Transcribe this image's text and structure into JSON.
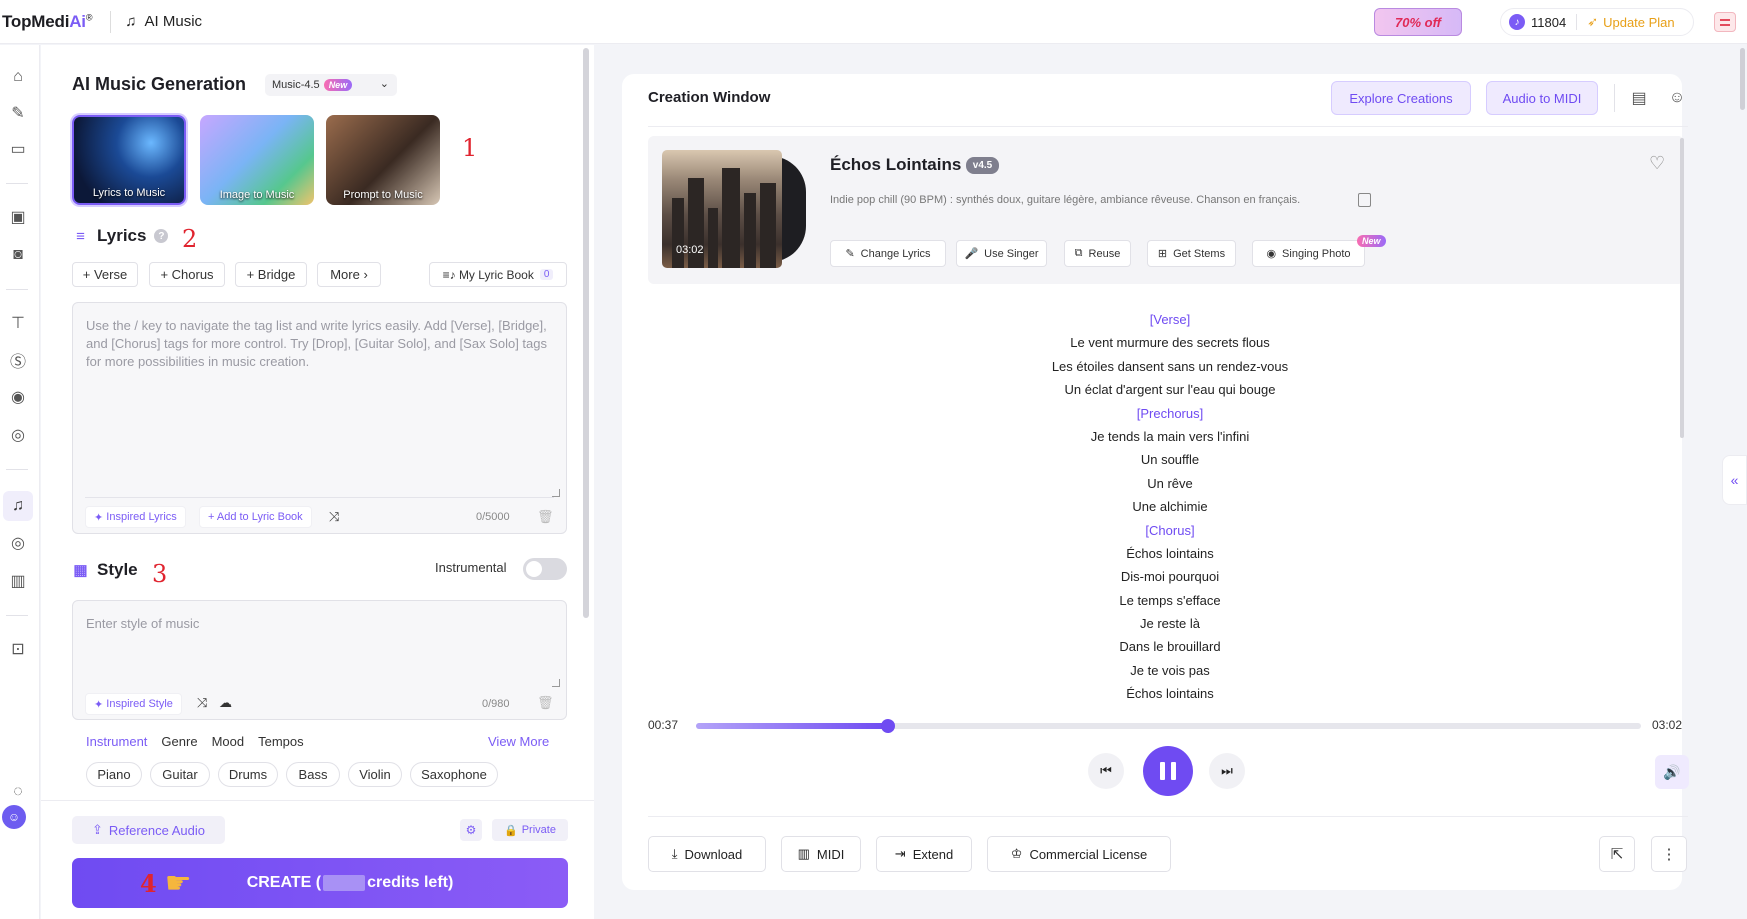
{
  "topbar": {
    "logo_text": "TopMedi",
    "logo_ai": "Ai",
    "logo_reg": "®",
    "app_icon": "music-note-icon",
    "app_title": "AI Music",
    "promo": "70% off",
    "credits": "11804",
    "update_plan": "Update Plan"
  },
  "sidebar": {
    "icons": [
      "home-icon",
      "brush-icon",
      "folder-icon",
      "video-ai-icon",
      "camera-icon",
      "translate-icon",
      "subtitle-icon",
      "voice-icon",
      "image-ai-icon",
      "music-note-icon",
      "vinyl-icon",
      "piano-icon",
      "ai-chip-icon",
      "discord-icon",
      "chat-icon"
    ]
  },
  "generation": {
    "title": "AI Music Generation",
    "model": "Music-4.5",
    "model_badge": "New",
    "modes": [
      "Lyrics to Music",
      "Image to Music",
      "Prompt to Music"
    ],
    "annotations": [
      "1",
      "2",
      "3",
      "4"
    ]
  },
  "lyrics": {
    "title": "Lyrics",
    "help": "?",
    "tags": [
      "+ Verse",
      "+ Chorus",
      "+ Bridge",
      "More"
    ],
    "lyric_book": "My Lyric Book",
    "lyric_book_count": "0",
    "placeholder": "Use the / key to navigate the tag list and write lyrics easily. Add [Verse], [Bridge], and [Chorus] tags for more control. Try [Drop], [Guitar Solo], and [Sax Solo] tags for more possibilities in music creation.",
    "inspired": "Inspired Lyrics",
    "add_book": "+ Add to Lyric Book",
    "counter": "0/5000"
  },
  "style": {
    "title": "Style",
    "instrumental": "Instrumental",
    "placeholder": "Enter style of music",
    "inspired": "Inspired Style",
    "counter": "0/980",
    "filter_tabs": [
      "Instrument",
      "Genre",
      "Mood",
      "Tempos"
    ],
    "view_more": "View More",
    "pills": [
      "Piano",
      "Guitar",
      "Drums",
      "Bass",
      "Violin",
      "Saxophone"
    ]
  },
  "bottom": {
    "reference_audio": "Reference Audio",
    "private": "Private",
    "create_prefix": "CREATE (",
    "create_suffix": " credits left)"
  },
  "creation": {
    "title": "Creation Window",
    "explore": "Explore Creations",
    "audio_to_midi": "Audio to MIDI",
    "song": {
      "title": "Échos Lointains",
      "version": "v4.5",
      "description": "Indie pop chill (90 BPM) : synthés doux, guitare légère, ambiance rêveuse. Chanson en français.",
      "duration": "03:02",
      "actions": [
        "Change Lyrics",
        "Use Singer",
        "Reuse",
        "Get Stems",
        "Singing Photo"
      ],
      "action_new": "New"
    },
    "lyrics": [
      {
        "text": "[Verse]",
        "tag": true
      },
      {
        "text": "Le vent murmure des secrets flous",
        "tag": false
      },
      {
        "text": "Les étoiles dansent sans un rendez-vous",
        "tag": false
      },
      {
        "text": "Un éclat d'argent sur l'eau qui bouge",
        "tag": false
      },
      {
        "text": "[Prechorus]",
        "tag": true
      },
      {
        "text": "Je tends la main vers l'infini",
        "tag": false
      },
      {
        "text": "Un souffle",
        "tag": false
      },
      {
        "text": "Un rêve",
        "tag": false
      },
      {
        "text": "Une alchimie",
        "tag": false
      },
      {
        "text": "[Chorus]",
        "tag": true
      },
      {
        "text": "Échos lointains",
        "tag": false
      },
      {
        "text": "Dis-moi pourquoi",
        "tag": false
      },
      {
        "text": "Le temps s'efface",
        "tag": false
      },
      {
        "text": "Je reste là",
        "tag": false
      },
      {
        "text": "Dans le brouillard",
        "tag": false
      },
      {
        "text": "Je te vois pas",
        "tag": false
      },
      {
        "text": "Échos lointains",
        "tag": false
      }
    ],
    "player": {
      "current": "00:37",
      "total": "03:02",
      "progress": 0.203
    },
    "footer": [
      "Download",
      "MIDI",
      "Extend",
      "Commercial License"
    ]
  }
}
